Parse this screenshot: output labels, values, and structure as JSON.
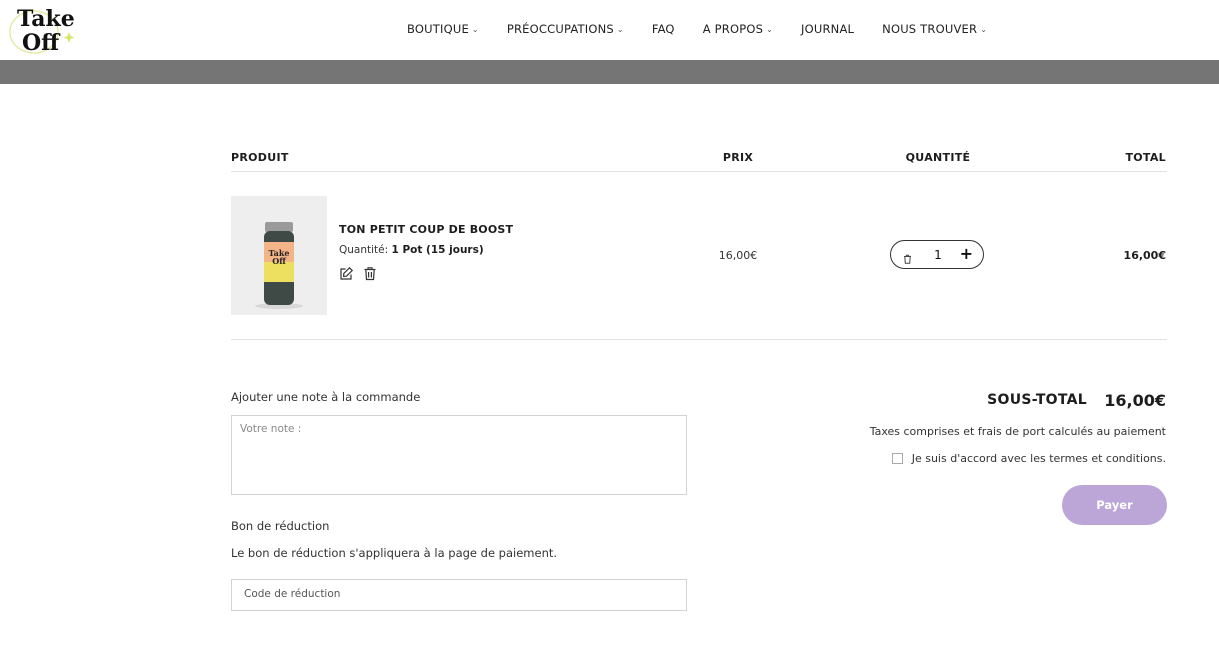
{
  "header": {
    "logo_text": "Take Off",
    "nav": [
      {
        "label": "BOUTIQUE",
        "has_dropdown": true
      },
      {
        "label": "PRÉOCCUPATIONS",
        "has_dropdown": true
      },
      {
        "label": "FAQ",
        "has_dropdown": false
      },
      {
        "label": "A PROPOS",
        "has_dropdown": true
      },
      {
        "label": "JOURNAL",
        "has_dropdown": false
      },
      {
        "label": "NOUS TROUVER",
        "has_dropdown": true
      }
    ]
  },
  "cart": {
    "columns": {
      "product": "PRODUIT",
      "price": "PRIX",
      "quantity": "QUANTITÉ",
      "total": "TOTAL"
    },
    "items": [
      {
        "name": "TON PETIT COUP DE BOOST",
        "variant_label": "Quantité:",
        "variant_value": "1 Pot (15 jours)",
        "price": "16,00€",
        "quantity": "1",
        "total": "16,00€"
      }
    ]
  },
  "note": {
    "label": "Ajouter une note à la commande",
    "placeholder": "Votre note :"
  },
  "coupon": {
    "title": "Bon de réduction",
    "help": "Le bon de réduction s'appliquera à la page de paiement.",
    "placeholder": "Code de réduction"
  },
  "summary": {
    "subtotal_label": "SOUS-TOTAL",
    "subtotal_value": "16,00€",
    "tax_note": "Taxes comprises et frais de port calculés au paiement",
    "terms_label": "Je suis d'accord avec les termes et conditions.",
    "pay_label": "Payer"
  },
  "colors": {
    "accent": "#bca6d8",
    "banner": "#757575"
  }
}
